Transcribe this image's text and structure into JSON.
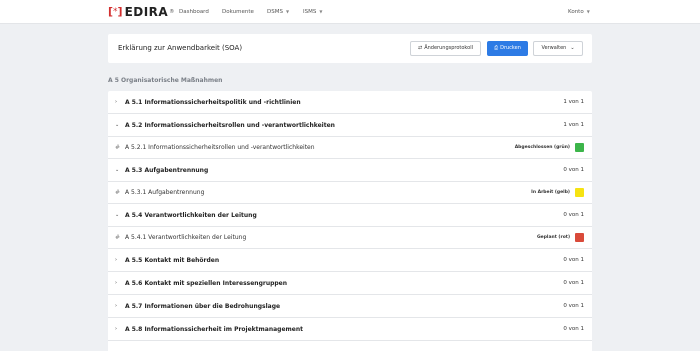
{
  "nav": {
    "logo_text": "EDIRA",
    "logo_star": "*",
    "logo_reg": "®",
    "items": [
      {
        "label": "Dashboard",
        "has_menu": false
      },
      {
        "label": "Dokumente",
        "has_menu": false
      },
      {
        "label": "DSMS",
        "has_menu": true
      },
      {
        "label": "ISMS",
        "has_menu": true
      }
    ],
    "account": "Konto"
  },
  "header": {
    "title": "Erklärung zur Anwendbarkeit (SOA)",
    "btn_changelog": "Änderungsprotokoll",
    "btn_print": "Drucken",
    "btn_manage": "Verwalten"
  },
  "section_label": "A 5 Organisatorische Maßnahmen",
  "rows": [
    {
      "type": "group",
      "expanded": false,
      "title": "A 5.1 Informationssicherheitspolitik und -richtlinien",
      "count": "1 von 1"
    },
    {
      "type": "group",
      "expanded": true,
      "title": "A 5.2 Informationssicherheitsrollen und -verantwortlichkeiten",
      "count": "1 von 1"
    },
    {
      "type": "child",
      "title": "A 5.2.1 Informationssicherheitsrollen und -verantwortlichkeiten",
      "status": "Abgeschlossen (grün)",
      "color": "#3cb54a"
    },
    {
      "type": "group",
      "expanded": true,
      "title": "A 5.3 Aufgabentrennung",
      "count": "0 von 1"
    },
    {
      "type": "child",
      "title": "A 5.3.1 Aufgabentrennung",
      "status": "In Arbeit (gelb)",
      "color": "#f6e312"
    },
    {
      "type": "group",
      "expanded": true,
      "title": "A 5.4 Verantwortlichkeiten der Leitung",
      "count": "0 von 1"
    },
    {
      "type": "child",
      "title": "A 5.4.1 Verantwortlichkeiten der Leitung",
      "status": "Geplant (rot)",
      "color": "#d94a3a"
    },
    {
      "type": "group",
      "expanded": false,
      "title": "A 5.5 Kontakt mit Behörden",
      "count": "0 von 1"
    },
    {
      "type": "group",
      "expanded": false,
      "title": "A 5.6 Kontakt mit speziellen Interessengruppen",
      "count": "0 von 1"
    },
    {
      "type": "group",
      "expanded": false,
      "title": "A 5.7 Informationen über die Bedrohungslage",
      "count": "0 von 1"
    },
    {
      "type": "group",
      "expanded": false,
      "title": "A 5.8 Informationssicherheit im Projektmanagement",
      "count": "0 von 1"
    }
  ]
}
